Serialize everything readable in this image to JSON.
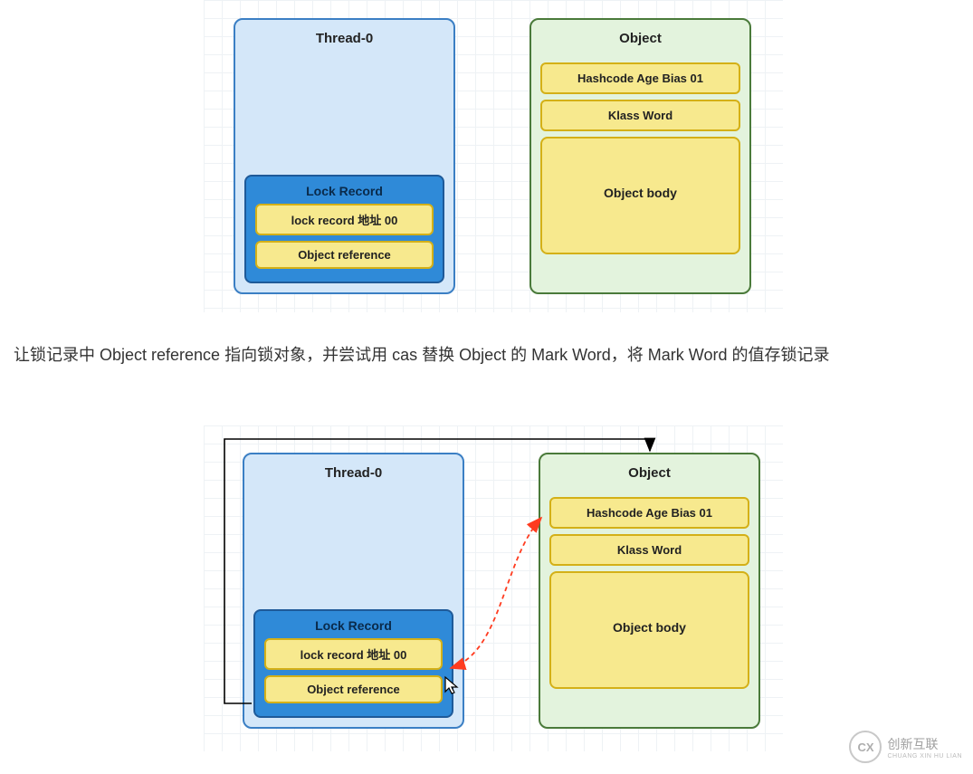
{
  "diagram1": {
    "thread": {
      "title": "Thread-0",
      "lock_record": {
        "title": "Lock Record",
        "addr": "lock record 地址 00",
        "ref": "Object reference"
      }
    },
    "object": {
      "title": "Object",
      "mark": "Hashcode Age Bias 01",
      "klass": "Klass Word",
      "body": "Object body"
    }
  },
  "paragraph": "让锁记录中 Object reference 指向锁对象，并尝试用 cas 替换 Object 的 Mark Word，将 Mark Word 的值存锁记录",
  "diagram2": {
    "thread": {
      "title": "Thread-0",
      "lock_record": {
        "title": "Lock Record",
        "addr": "lock record 地址 00",
        "ref": "Object reference"
      }
    },
    "object": {
      "title": "Object",
      "mark": "Hashcode Age Bias 01",
      "klass": "Klass Word",
      "body": "Object body"
    }
  },
  "logo": {
    "mark": "CX",
    "text": "创新互联",
    "sub": "CHUANG XIN HU LIAN"
  },
  "chart_data": {
    "type": "diagram",
    "description": "Java lightweight lock (轻量级锁) Lock Record and Object header state diagrams",
    "figures": [
      {
        "id": 1,
        "nodes": [
          {
            "id": "thread0",
            "label": "Thread-0",
            "children": [
              {
                "id": "lockrecord",
                "label": "Lock Record",
                "children": [
                  {
                    "id": "lr_addr",
                    "label": "lock record 地址 00"
                  },
                  {
                    "id": "lr_ref",
                    "label": "Object reference"
                  }
                ]
              }
            ]
          },
          {
            "id": "object",
            "label": "Object",
            "children": [
              {
                "id": "mark",
                "label": "Hashcode Age Bias 01"
              },
              {
                "id": "klass",
                "label": "Klass Word"
              },
              {
                "id": "body",
                "label": "Object body"
              }
            ]
          }
        ],
        "edges": []
      },
      {
        "id": 2,
        "nodes": [
          {
            "id": "thread0",
            "label": "Thread-0",
            "children": [
              {
                "id": "lockrecord",
                "label": "Lock Record",
                "children": [
                  {
                    "id": "lr_addr",
                    "label": "lock record 地址 00"
                  },
                  {
                    "id": "lr_ref",
                    "label": "Object reference"
                  }
                ]
              }
            ]
          },
          {
            "id": "object",
            "label": "Object",
            "children": [
              {
                "id": "mark",
                "label": "Hashcode Age Bias 01"
              },
              {
                "id": "klass",
                "label": "Klass Word"
              },
              {
                "id": "body",
                "label": "Object body"
              }
            ]
          }
        ],
        "edges": [
          {
            "from": "lr_ref",
            "to": "object",
            "style": "black-arrow",
            "note": "Object reference 指向锁对象"
          },
          {
            "from": "lr_addr",
            "to": "mark",
            "style": "red-dashed-double",
            "note": "cas 替换 Mark Word"
          }
        ]
      }
    ]
  }
}
